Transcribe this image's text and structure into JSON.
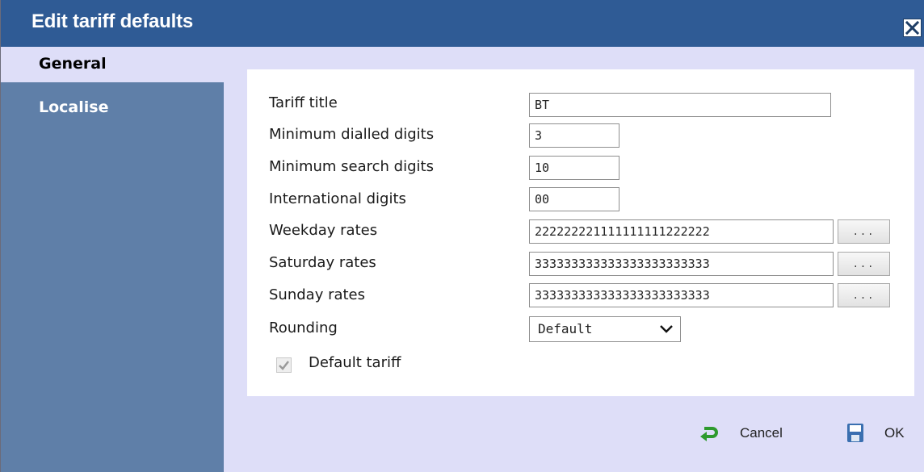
{
  "dialog": {
    "title": "Edit tariff defaults",
    "close_icon": "close-icon"
  },
  "sidebar": {
    "items": [
      {
        "label": "General",
        "active": true
      },
      {
        "label": "Localise",
        "active": false
      }
    ]
  },
  "form": {
    "tariff_title": {
      "label": "Tariff title",
      "value": "BT"
    },
    "min_dialled": {
      "label": "Minimum dialled digits",
      "value": "3"
    },
    "min_search": {
      "label": "Minimum search digits",
      "value": "10"
    },
    "international": {
      "label": "International digits",
      "value": "00"
    },
    "weekday": {
      "label": "Weekday rates",
      "value": "222222221111111111222222",
      "button": "..."
    },
    "saturday": {
      "label": "Saturday rates",
      "value": "333333333333333333333333",
      "button": "..."
    },
    "sunday": {
      "label": "Sunday rates",
      "value": "333333333333333333333333",
      "button": "..."
    },
    "rounding": {
      "label": "Rounding",
      "value": "Default",
      "icon": "chevron-down-icon"
    },
    "default_tariff": {
      "label": "Default tariff",
      "checked": true
    }
  },
  "footer": {
    "cancel": {
      "label": "Cancel",
      "icon": "undo-arrow-icon"
    },
    "ok": {
      "label": "OK",
      "icon": "save-disk-icon"
    }
  },
  "colors": {
    "titlebar": "#2f5b95",
    "sidebar": "#5f7fa8",
    "dialog_bg": "#dedef8",
    "panel": "#ffffff"
  }
}
